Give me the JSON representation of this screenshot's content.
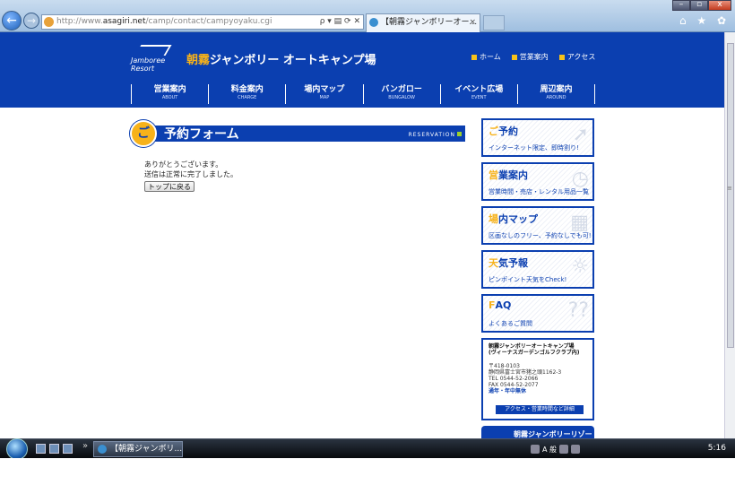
{
  "browser": {
    "url_prefix": "http://www.",
    "url_host": "asagiri.net",
    "url_path": "/camp/contact/campyoyaku.cgi",
    "addr_controls": "ρ ▾ ▤ ⟳ ✕",
    "tab_title": "【朝霧ジャンボリーオー...",
    "tab_close": "×",
    "back_icon": "←",
    "forward_icon": "→",
    "window_buttons": [
      "–",
      "▫",
      "x"
    ],
    "tools": "⌂ ★ ✿"
  },
  "header": {
    "logo_line1": "Jamboree",
    "logo_line2": "Resort",
    "site_name_accent": "朝霧",
    "site_name_rest": "ジャンボリー オートキャンプ場",
    "util_links": [
      "ホーム",
      "営業案内",
      "アクセス"
    ],
    "nav": [
      {
        "ja": "営業案内",
        "en": "ABOUT"
      },
      {
        "ja": "料金案内",
        "en": "CHARGE"
      },
      {
        "ja": "場内マップ",
        "en": "MAP"
      },
      {
        "ja": "バンガロー",
        "en": "BUNGALOW"
      },
      {
        "ja": "イベント広場",
        "en": "EVENT"
      },
      {
        "ja": "周辺案内",
        "en": "AROUND"
      }
    ]
  },
  "main": {
    "title_mark": "ご",
    "title": "予約フォーム",
    "title_en": "RESERVATION",
    "message_line1": "ありがとうございます。",
    "message_line2": "送信は正常に完了しました。",
    "back_button": "トップに戻る"
  },
  "sidebar": {
    "boxes": [
      {
        "head_mark": "ご",
        "head": "予約",
        "sub": "インターネット限定、即時割り!"
      },
      {
        "head_mark": "営",
        "head": "業案内",
        "sub": "営業時間・売店・レンタル用品一覧"
      },
      {
        "head_mark": "場",
        "head": "内マップ",
        "sub": "区画なしのフリー、予約なしでも可!"
      },
      {
        "head_mark": "天",
        "head": "気予報",
        "sub": "ピンポイント天気をCheck!"
      },
      {
        "head_mark": "F",
        "head": "AQ",
        "sub": "よくあるご質問"
      }
    ],
    "info": {
      "name": "朝霧ジャンボリーオートキャンプ場",
      "name_sub": "(ヴィーナスガーデンゴルフクラブ内)",
      "zip": "〒418-0103",
      "address": "静岡県富士宮市猪之頭1162-3",
      "tel": "TEL 0544-52-2066",
      "fax": "FAX 0544-52-2077",
      "holiday": "通年・年中無休",
      "link": "アクセス・営業時間など詳細"
    },
    "resort_banner": "朝霧ジャンボリーリゾート"
  },
  "taskbar": {
    "task_label": "【朝霧ジャンボリ...",
    "ime": "A 般",
    "clock": "5:16"
  },
  "colors": {
    "brand_blue": "#0b3fb0",
    "accent_orange": "#f7b21a",
    "accent_green": "#9dd12a"
  }
}
